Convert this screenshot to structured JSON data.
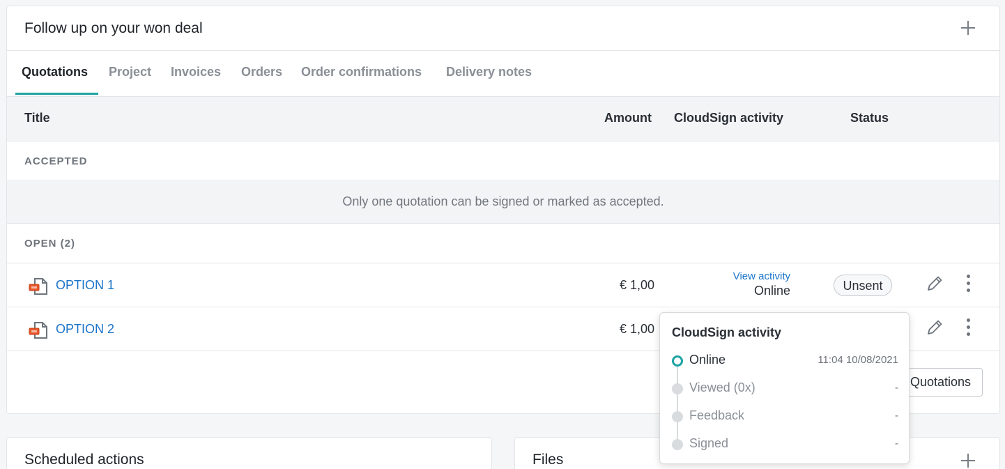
{
  "card": {
    "title": "Follow up on your won deal",
    "add_icon": "plus-icon"
  },
  "tabs": [
    {
      "label": "Quotations",
      "active": true
    },
    {
      "label": "Project"
    },
    {
      "label": "Invoices"
    },
    {
      "label": "Orders"
    },
    {
      "label": "Order confirmations"
    },
    {
      "label": "Delivery notes"
    }
  ],
  "table": {
    "headers": {
      "title": "Title",
      "amount": "Amount",
      "activity": "CloudSign activity",
      "status": "Status"
    },
    "accepted_label": "ACCEPTED",
    "accepted_notice": "Only one quotation can be signed or marked as accepted.",
    "open_label": "OPEN (2)",
    "rows": [
      {
        "title": "OPTION 1",
        "amount": "€ 1,00",
        "view_activity": "View activity",
        "activity_status": "Online",
        "status": "Unsent"
      },
      {
        "title": "OPTION 2",
        "amount": "€ 1,00"
      }
    ]
  },
  "footer_button_label": "Quotations",
  "popover": {
    "title": "CloudSign activity",
    "steps": [
      {
        "label": "Online",
        "time": "11:04 10/08/2021",
        "active": true
      },
      {
        "label": "Viewed (0x)",
        "time": "-"
      },
      {
        "label": "Feedback",
        "time": "-"
      },
      {
        "label": "Signed",
        "time": "-"
      }
    ]
  },
  "bottom_cards": {
    "scheduled_title": "Scheduled actions",
    "files_title": "Files"
  },
  "colors": {
    "accent": "#1fa3a3",
    "link": "#1a73c9",
    "icon_orange": "#e8562a"
  }
}
